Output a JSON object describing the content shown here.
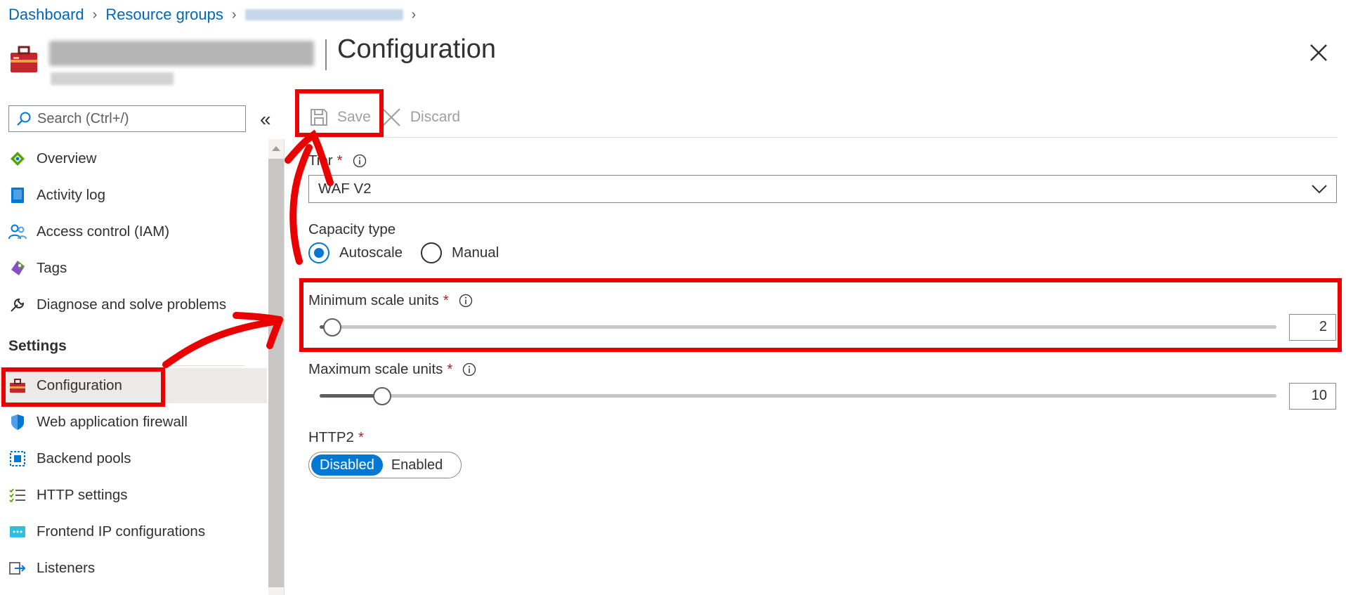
{
  "breadcrumb": {
    "items": [
      "Dashboard",
      "Resource groups"
    ]
  },
  "header": {
    "title": "Configuration",
    "close_icon": "close-icon"
  },
  "sidebar": {
    "search_placeholder": "Search (Ctrl+/)",
    "collapse_label": "«",
    "items": [
      {
        "label": "Overview",
        "icon": "overview-icon"
      },
      {
        "label": "Activity log",
        "icon": "activity-log-icon"
      },
      {
        "label": "Access control (IAM)",
        "icon": "iam-icon"
      },
      {
        "label": "Tags",
        "icon": "tag-icon"
      },
      {
        "label": "Diagnose and solve problems",
        "icon": "wrench-icon"
      }
    ],
    "settings_label": "Settings",
    "settings_items": [
      {
        "label": "Configuration",
        "icon": "toolbox-icon",
        "active": true
      },
      {
        "label": "Web application firewall",
        "icon": "shield-icon"
      },
      {
        "label": "Backend pools",
        "icon": "backend-pool-icon"
      },
      {
        "label": "HTTP settings",
        "icon": "list-settings-icon"
      },
      {
        "label": "Frontend IP configurations",
        "icon": "frontend-ip-icon"
      },
      {
        "label": "Listeners",
        "icon": "listener-icon"
      }
    ]
  },
  "toolbar": {
    "save_label": "Save",
    "discard_label": "Discard"
  },
  "form": {
    "tier": {
      "label": "Tier",
      "required": "*",
      "value": "WAF V2"
    },
    "capacity_type": {
      "label": "Capacity type",
      "options": [
        "Autoscale",
        "Manual"
      ],
      "selected": "Autoscale"
    },
    "min_scale": {
      "label": "Minimum scale units",
      "required": "*",
      "value": "2",
      "fraction": 0.013
    },
    "max_scale": {
      "label": "Maximum scale units",
      "required": "*",
      "value": "10",
      "fraction": 0.065
    },
    "http2": {
      "label": "HTTP2",
      "required": "*",
      "options": [
        "Disabled",
        "Enabled"
      ],
      "selected": "Disabled"
    }
  },
  "colors": {
    "accent": "#0078d4",
    "link": "#0067b8",
    "annotation": "#ea0000",
    "required": "#a4262c"
  }
}
